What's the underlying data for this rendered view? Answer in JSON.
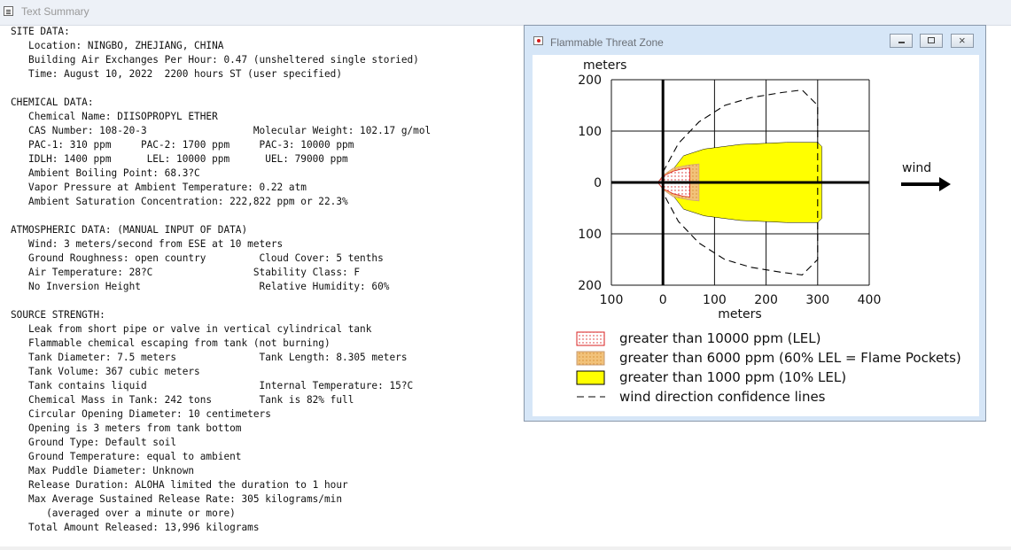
{
  "window": {
    "title": "Text Summary"
  },
  "summary_lines": [
    "SITE DATA:",
    "   Location: NINGBO, ZHEJIANG, CHINA",
    "   Building Air Exchanges Per Hour: 0.47 (unsheltered single storied)",
    "   Time: August 10, 2022  2200 hours ST (user specified)",
    "",
    "CHEMICAL DATA:",
    "   Chemical Name: DIISOPROPYL ETHER",
    "   CAS Number: 108-20-3                  Molecular Weight: 102.17 g/mol",
    "   PAC-1: 310 ppm     PAC-2: 1700 ppm     PAC-3: 10000 ppm",
    "   IDLH: 1400 ppm      LEL: 10000 ppm      UEL: 79000 ppm",
    "   Ambient Boiling Point: 68.3?C",
    "   Vapor Pressure at Ambient Temperature: 0.22 atm",
    "   Ambient Saturation Concentration: 222,822 ppm or 22.3%",
    "",
    "ATMOSPHERIC DATA: (MANUAL INPUT OF DATA)",
    "   Wind: 3 meters/second from ESE at 10 meters",
    "   Ground Roughness: open country         Cloud Cover: 5 tenths",
    "   Air Temperature: 28?C                 Stability Class: F",
    "   No Inversion Height                    Relative Humidity: 60%",
    "",
    "SOURCE STRENGTH:",
    "   Leak from short pipe or valve in vertical cylindrical tank",
    "   Flammable chemical escaping from tank (not burning)",
    "   Tank Diameter: 7.5 meters              Tank Length: 8.305 meters",
    "   Tank Volume: 367 cubic meters",
    "   Tank contains liquid                   Internal Temperature: 15?C",
    "   Chemical Mass in Tank: 242 tons        Tank is 82% full",
    "   Circular Opening Diameter: 10 centimeters",
    "   Opening is 3 meters from tank bottom",
    "   Ground Type: Default soil",
    "   Ground Temperature: equal to ambient",
    "   Max Puddle Diameter: Unknown",
    "   Release Duration: ALOHA limited the duration to 1 hour",
    "   Max Average Sustained Release Rate: 305 kilograms/min",
    "      (averaged over a minute or more)",
    "   Total Amount Released: 13,996 kilograms"
  ],
  "child_window": {
    "title": "Flammable Threat Zone",
    "buttons": [
      "minimize",
      "maximize",
      "close"
    ]
  },
  "chart_data": {
    "type": "area",
    "xlabel": "meters",
    "ylabel": "meters",
    "x_ticks": [
      "100",
      "0",
      "100",
      "200",
      "300",
      "400"
    ],
    "y_ticks": [
      "200",
      "100",
      "0",
      "100",
      "200"
    ],
    "xlim": [
      -100,
      400
    ],
    "ylim": [
      -200,
      200
    ],
    "grid": true,
    "legend": [
      {
        "label": "greater than 10000 ppm (LEL)",
        "style": "red-dotted",
        "color": "#d92020"
      },
      {
        "label": "greater than 6000 ppm (60% LEL = Flame Pockets)",
        "style": "orange-dotted",
        "color": "#d58b2f"
      },
      {
        "label": "greater than 1000 ppm (10% LEL)",
        "style": "yellow-solid",
        "color": "#ffff00"
      },
      {
        "label": "wind direction confidence lines",
        "style": "dashed",
        "color": "#000000"
      }
    ],
    "wind_label": "wind",
    "series": [
      {
        "points": [
          [
            0,
            0
          ],
          [
            40,
            52
          ],
          [
            80,
            65
          ],
          [
            150,
            74
          ],
          [
            240,
            78
          ],
          [
            300,
            78
          ],
          [
            308,
            70
          ],
          [
            308,
            -70
          ],
          [
            300,
            -78
          ],
          [
            240,
            -78
          ],
          [
            150,
            -74
          ],
          [
            80,
            -65
          ],
          [
            40,
            -52
          ],
          [
            0,
            0
          ]
        ],
        "color": "#ffff00"
      },
      {
        "points": [
          [
            -10,
            0
          ],
          [
            0,
            14
          ],
          [
            20,
            28
          ],
          [
            50,
            34
          ],
          [
            70,
            36
          ],
          [
            70,
            -36
          ],
          [
            50,
            -34
          ],
          [
            20,
            -28
          ],
          [
            0,
            -14
          ],
          [
            -10,
            0
          ]
        ],
        "color": "#f2c27a"
      },
      {
        "points": [
          [
            -10,
            0
          ],
          [
            0,
            12
          ],
          [
            20,
            22
          ],
          [
            40,
            27
          ],
          [
            52,
            28
          ],
          [
            52,
            -28
          ],
          [
            40,
            -27
          ],
          [
            20,
            -22
          ],
          [
            0,
            -12
          ],
          [
            -10,
            0
          ]
        ],
        "color": "#ffdede"
      },
      {
        "points": [
          [
            0,
            20
          ],
          [
            30,
            76
          ],
          [
            70,
            118
          ],
          [
            120,
            150
          ],
          [
            170,
            165
          ],
          [
            230,
            175
          ],
          [
            270,
            180
          ],
          [
            300,
            150
          ],
          [
            300,
            -150
          ],
          [
            270,
            -180
          ],
          [
            230,
            -175
          ],
          [
            170,
            -165
          ],
          [
            120,
            -150
          ],
          [
            70,
            -118
          ],
          [
            30,
            -76
          ],
          [
            0,
            -20
          ]
        ],
        "color": "#000000"
      }
    ]
  }
}
